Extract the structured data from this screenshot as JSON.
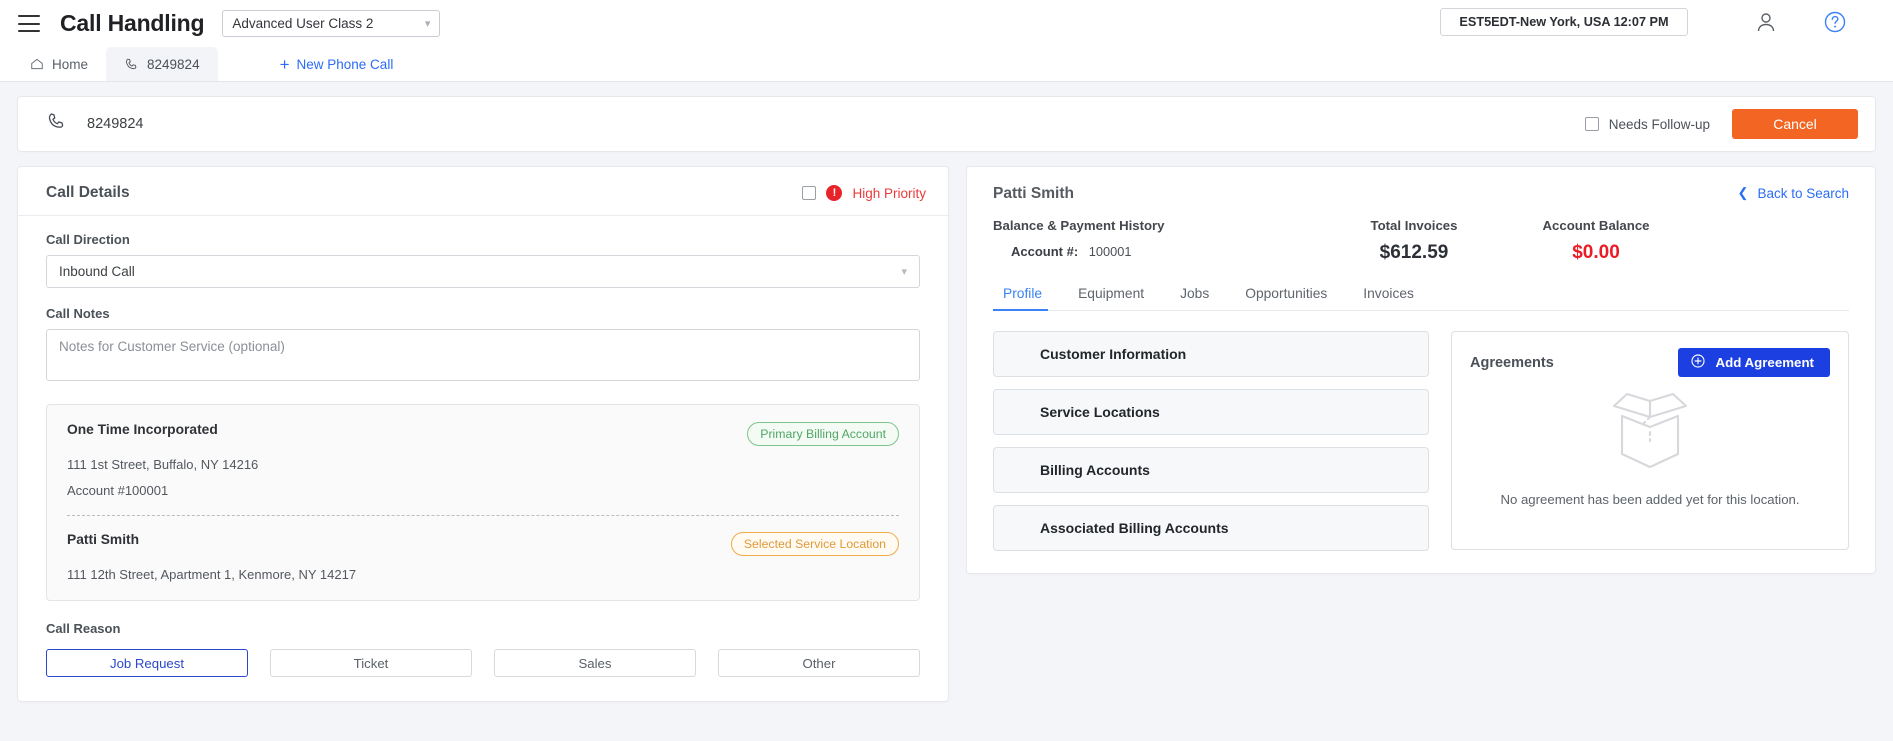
{
  "appbar": {
    "menu_icon": "hamburger-icon",
    "title": "Call Handling",
    "user_class": "Advanced User Class 2",
    "timezone": "EST5EDT-New York, USA 12:07 PM",
    "user_icon": "user-icon",
    "help_icon": "help-icon"
  },
  "tabstrip": {
    "home_label": "Home",
    "home_icon": "home-icon",
    "call_tab_label": "8249824",
    "call_tab_icon": "phone-icon",
    "new_call_label": "New Phone Call",
    "new_call_icon": "plus-icon"
  },
  "callbar": {
    "phone_icon": "phone-icon",
    "number": "8249824",
    "follow_up_label": "Needs Follow-up",
    "follow_up_checked": false,
    "cancel_label": "Cancel"
  },
  "call_details": {
    "title": "Call Details",
    "high_priority_label": "High Priority",
    "high_priority_checked": false,
    "call_direction_label": "Call Direction",
    "call_direction_value": "Inbound Call",
    "call_notes_label": "Call Notes",
    "call_notes_value": "",
    "call_notes_placeholder": "Notes for Customer Service (optional)",
    "account_card": {
      "company": "One Time Incorporated",
      "company_badge": "Primary Billing Account",
      "company_address": "111 1st Street, Buffalo, NY 14216",
      "company_account": "Account #100001",
      "person": "Patti  Smith",
      "person_badge": "Selected Service Location",
      "person_address": "111 12th Street, Apartment 1, Kenmore, NY 14217"
    },
    "call_reason_label": "Call Reason",
    "call_reason_options": [
      "Job Request",
      "Ticket",
      "Sales",
      "Other"
    ],
    "call_reason_selected": "Job Request"
  },
  "customer_panel": {
    "name": "Patti Smith",
    "back_to_search": "Back to Search",
    "back_icon": "chevron-left-icon",
    "balance_history_label": "Balance & Payment History",
    "account_number_label": "Account #:",
    "account_number_value": "100001",
    "total_invoices_label": "Total Invoices",
    "total_invoices_value": "$612.59",
    "account_balance_label": "Account Balance",
    "account_balance_value": "$0.00",
    "account_balance_color": "#ea1c26",
    "tabs": [
      "Profile",
      "Equipment",
      "Jobs",
      "Opportunities",
      "Invoices"
    ],
    "active_tab": "Profile",
    "accordions": [
      "Customer Information",
      "Service Locations",
      "Billing Accounts",
      "Associated Billing Accounts"
    ],
    "agreements": {
      "title": "Agreements",
      "add_label": "Add Agreement",
      "add_icon": "plus-circle-icon",
      "empty_icon": "open-box-icon",
      "empty_text": "No agreement has been added yet for this location."
    }
  },
  "colors": {
    "accent_blue": "#2b6cf6",
    "primary_blue": "#1b3fe0",
    "orange": "#f26522",
    "danger_red": "#ea1c26",
    "green": "#4fa763"
  }
}
